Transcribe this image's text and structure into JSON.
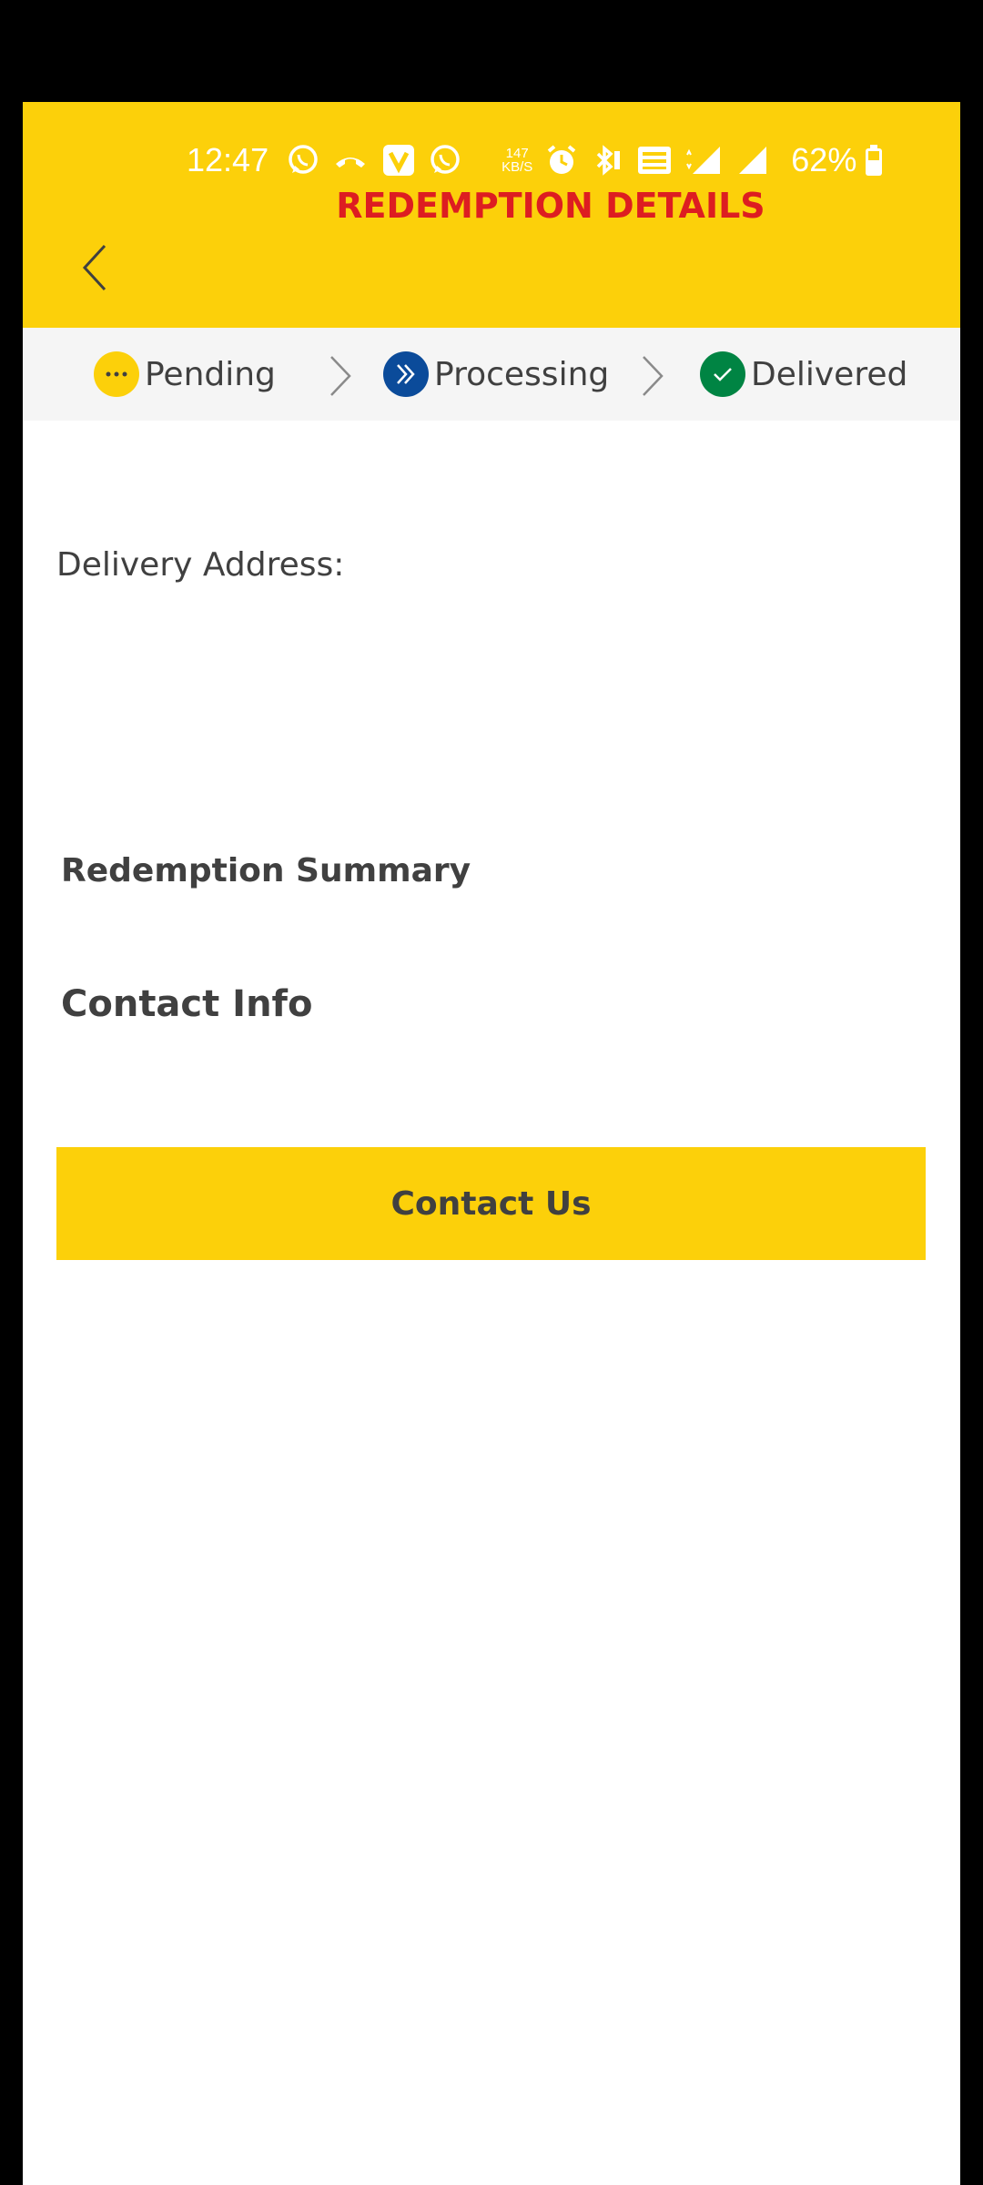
{
  "status_bar": {
    "time": "12:47",
    "speed_value": "147",
    "speed_unit": "KB/S",
    "battery_percent": "62%",
    "icons": [
      "whatsapp-icon",
      "missed-call-icon",
      "v-app-icon",
      "whatsapp-icon",
      "alarm-icon",
      "bluetooth-icon",
      "volte-icon",
      "4g-signal-icon",
      "signal-icon",
      "battery-icon"
    ]
  },
  "header": {
    "title": "REDEMPTION DETAILS",
    "back_icon": "chevron-left-icon"
  },
  "steps": [
    {
      "label": "Pending",
      "icon": "more-dots-icon",
      "color": "#FCD00A"
    },
    {
      "label": "Processing",
      "icon": "double-chevron-right-icon",
      "color": "#0B4B9A"
    },
    {
      "label": "Delivered",
      "icon": "check-icon",
      "color": "#008443"
    }
  ],
  "content": {
    "delivery_label": "Delivery Address:",
    "summary_title": "Redemption Summary",
    "contact_title": "Contact Info",
    "contact_button": "Contact Us"
  },
  "colors": {
    "header_bg": "#FCD00A",
    "title_red": "#DD1D21",
    "text_dark": "#404040",
    "steps_bg": "#F5F5F5"
  }
}
